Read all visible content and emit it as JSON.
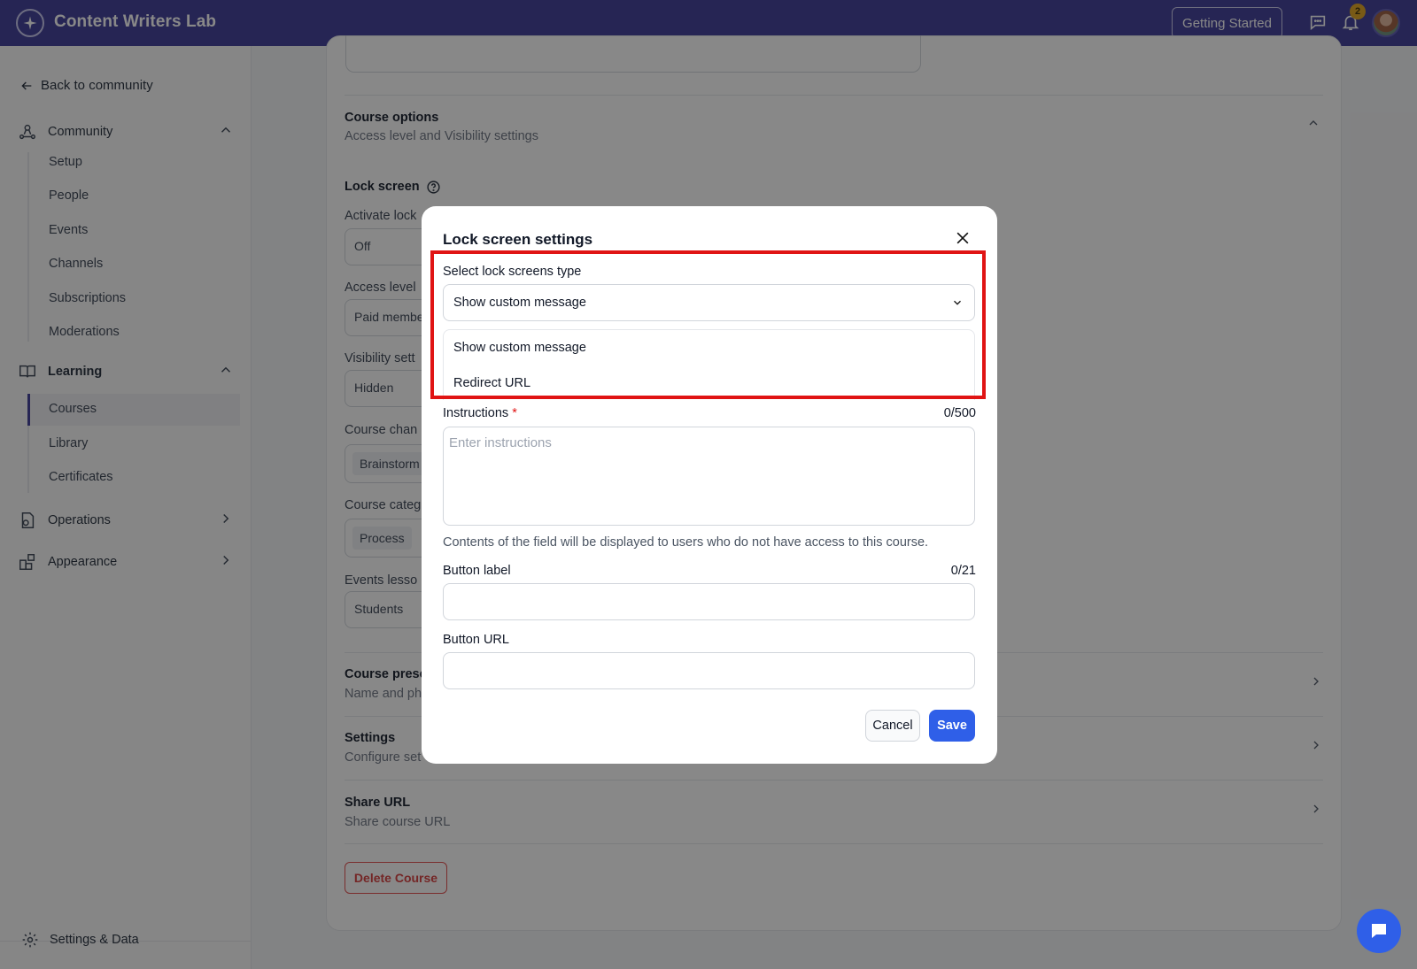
{
  "app": {
    "title": "Content Writers Lab",
    "getting_started": "Getting Started",
    "notifications_count": "2"
  },
  "sidebar": {
    "back": "Back to community",
    "community": {
      "label": "Community",
      "items": [
        "Setup",
        "People",
        "Events",
        "Channels",
        "Subscriptions",
        "Moderations"
      ]
    },
    "learning": {
      "label": "Learning",
      "items": [
        "Courses",
        "Library",
        "Certificates"
      ],
      "active": "Courses"
    },
    "operations": "Operations",
    "appearance": "Appearance",
    "settings_data": "Settings & Data"
  },
  "main": {
    "course_options_title": "Course options",
    "course_options_sub": "Access level and Visibility settings",
    "lock_screen": "Lock screen",
    "activate_lock_label": "Activate lock",
    "activate_lock_value": "Off",
    "access_level_label": "Access level",
    "access_level_value": "Paid membe",
    "visibility_label": "Visibility sett",
    "visibility_value": "Hidden",
    "course_channel_label": "Course chan",
    "course_channel_chip": "Brainstorm",
    "course_category_label": "Course categ",
    "course_category_chip": "Process",
    "events_lesson_label": "Events lesso",
    "events_lesson_value": "Students",
    "course_presentation_title": "Course prese",
    "course_presentation_sub": "Name and ph",
    "settings_title": "Settings",
    "settings_sub": "Configure set",
    "share_url_title": "Share URL",
    "share_url_sub": "Share course URL",
    "delete_course": "Delete Course"
  },
  "modal": {
    "title": "Lock screen settings",
    "select_label": "Select lock screens type",
    "select_value": "Show custom message",
    "options": [
      "Show custom message",
      "Redirect URL"
    ],
    "instructions_label": "Instructions",
    "required_mark": "*",
    "instructions_count": "0/500",
    "instructions_placeholder": "Enter instructions",
    "hint": "Contents of the field will be displayed to users who do not have access to this course.",
    "button_label": "Button label",
    "button_label_count": "0/21",
    "button_url": "Button URL",
    "cancel": "Cancel",
    "save": "Save"
  },
  "colors": {
    "topbar": "#3b3896",
    "highlight": "#e01414",
    "primary": "#2f5fe8",
    "danger": "#d63a3a"
  },
  "icons": [
    "logo-star-icon",
    "chat-bubble-icon",
    "bell-icon",
    "arrow-left-icon",
    "community-icon",
    "book-icon",
    "operations-icon",
    "appearance-icon",
    "gear-icon",
    "chevron-up-icon",
    "chevron-right-icon",
    "chevron-down-icon",
    "close-icon",
    "help-circle-icon"
  ]
}
